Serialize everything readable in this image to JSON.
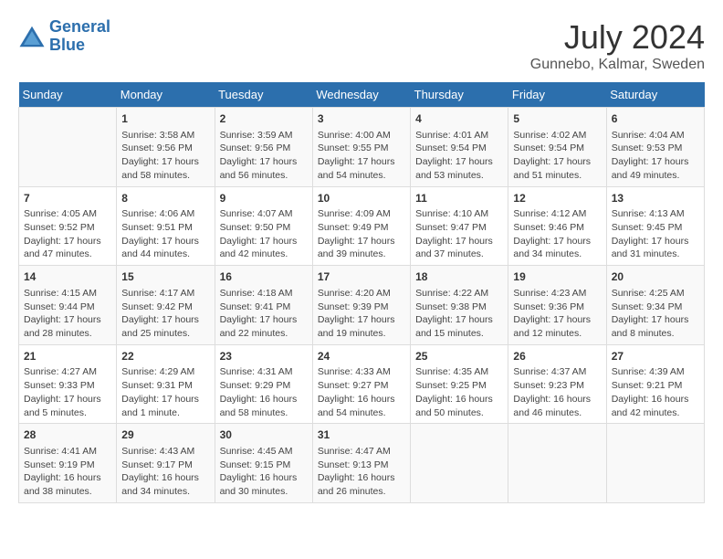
{
  "header": {
    "logo_line1": "General",
    "logo_line2": "Blue",
    "month_year": "July 2024",
    "location": "Gunnebo, Kalmar, Sweden"
  },
  "days_of_week": [
    "Sunday",
    "Monday",
    "Tuesday",
    "Wednesday",
    "Thursday",
    "Friday",
    "Saturday"
  ],
  "weeks": [
    [
      {
        "day": "",
        "content": ""
      },
      {
        "day": "1",
        "content": "Sunrise: 3:58 AM\nSunset: 9:56 PM\nDaylight: 17 hours\nand 58 minutes."
      },
      {
        "day": "2",
        "content": "Sunrise: 3:59 AM\nSunset: 9:56 PM\nDaylight: 17 hours\nand 56 minutes."
      },
      {
        "day": "3",
        "content": "Sunrise: 4:00 AM\nSunset: 9:55 PM\nDaylight: 17 hours\nand 54 minutes."
      },
      {
        "day": "4",
        "content": "Sunrise: 4:01 AM\nSunset: 9:54 PM\nDaylight: 17 hours\nand 53 minutes."
      },
      {
        "day": "5",
        "content": "Sunrise: 4:02 AM\nSunset: 9:54 PM\nDaylight: 17 hours\nand 51 minutes."
      },
      {
        "day": "6",
        "content": "Sunrise: 4:04 AM\nSunset: 9:53 PM\nDaylight: 17 hours\nand 49 minutes."
      }
    ],
    [
      {
        "day": "7",
        "content": "Sunrise: 4:05 AM\nSunset: 9:52 PM\nDaylight: 17 hours\nand 47 minutes."
      },
      {
        "day": "8",
        "content": "Sunrise: 4:06 AM\nSunset: 9:51 PM\nDaylight: 17 hours\nand 44 minutes."
      },
      {
        "day": "9",
        "content": "Sunrise: 4:07 AM\nSunset: 9:50 PM\nDaylight: 17 hours\nand 42 minutes."
      },
      {
        "day": "10",
        "content": "Sunrise: 4:09 AM\nSunset: 9:49 PM\nDaylight: 17 hours\nand 39 minutes."
      },
      {
        "day": "11",
        "content": "Sunrise: 4:10 AM\nSunset: 9:47 PM\nDaylight: 17 hours\nand 37 minutes."
      },
      {
        "day": "12",
        "content": "Sunrise: 4:12 AM\nSunset: 9:46 PM\nDaylight: 17 hours\nand 34 minutes."
      },
      {
        "day": "13",
        "content": "Sunrise: 4:13 AM\nSunset: 9:45 PM\nDaylight: 17 hours\nand 31 minutes."
      }
    ],
    [
      {
        "day": "14",
        "content": "Sunrise: 4:15 AM\nSunset: 9:44 PM\nDaylight: 17 hours\nand 28 minutes."
      },
      {
        "day": "15",
        "content": "Sunrise: 4:17 AM\nSunset: 9:42 PM\nDaylight: 17 hours\nand 25 minutes."
      },
      {
        "day": "16",
        "content": "Sunrise: 4:18 AM\nSunset: 9:41 PM\nDaylight: 17 hours\nand 22 minutes."
      },
      {
        "day": "17",
        "content": "Sunrise: 4:20 AM\nSunset: 9:39 PM\nDaylight: 17 hours\nand 19 minutes."
      },
      {
        "day": "18",
        "content": "Sunrise: 4:22 AM\nSunset: 9:38 PM\nDaylight: 17 hours\nand 15 minutes."
      },
      {
        "day": "19",
        "content": "Sunrise: 4:23 AM\nSunset: 9:36 PM\nDaylight: 17 hours\nand 12 minutes."
      },
      {
        "day": "20",
        "content": "Sunrise: 4:25 AM\nSunset: 9:34 PM\nDaylight: 17 hours\nand 8 minutes."
      }
    ],
    [
      {
        "day": "21",
        "content": "Sunrise: 4:27 AM\nSunset: 9:33 PM\nDaylight: 17 hours\nand 5 minutes."
      },
      {
        "day": "22",
        "content": "Sunrise: 4:29 AM\nSunset: 9:31 PM\nDaylight: 17 hours\nand 1 minute."
      },
      {
        "day": "23",
        "content": "Sunrise: 4:31 AM\nSunset: 9:29 PM\nDaylight: 16 hours\nand 58 minutes."
      },
      {
        "day": "24",
        "content": "Sunrise: 4:33 AM\nSunset: 9:27 PM\nDaylight: 16 hours\nand 54 minutes."
      },
      {
        "day": "25",
        "content": "Sunrise: 4:35 AM\nSunset: 9:25 PM\nDaylight: 16 hours\nand 50 minutes."
      },
      {
        "day": "26",
        "content": "Sunrise: 4:37 AM\nSunset: 9:23 PM\nDaylight: 16 hours\nand 46 minutes."
      },
      {
        "day": "27",
        "content": "Sunrise: 4:39 AM\nSunset: 9:21 PM\nDaylight: 16 hours\nand 42 minutes."
      }
    ],
    [
      {
        "day": "28",
        "content": "Sunrise: 4:41 AM\nSunset: 9:19 PM\nDaylight: 16 hours\nand 38 minutes."
      },
      {
        "day": "29",
        "content": "Sunrise: 4:43 AM\nSunset: 9:17 PM\nDaylight: 16 hours\nand 34 minutes."
      },
      {
        "day": "30",
        "content": "Sunrise: 4:45 AM\nSunset: 9:15 PM\nDaylight: 16 hours\nand 30 minutes."
      },
      {
        "day": "31",
        "content": "Sunrise: 4:47 AM\nSunset: 9:13 PM\nDaylight: 16 hours\nand 26 minutes."
      },
      {
        "day": "",
        "content": ""
      },
      {
        "day": "",
        "content": ""
      },
      {
        "day": "",
        "content": ""
      }
    ]
  ]
}
